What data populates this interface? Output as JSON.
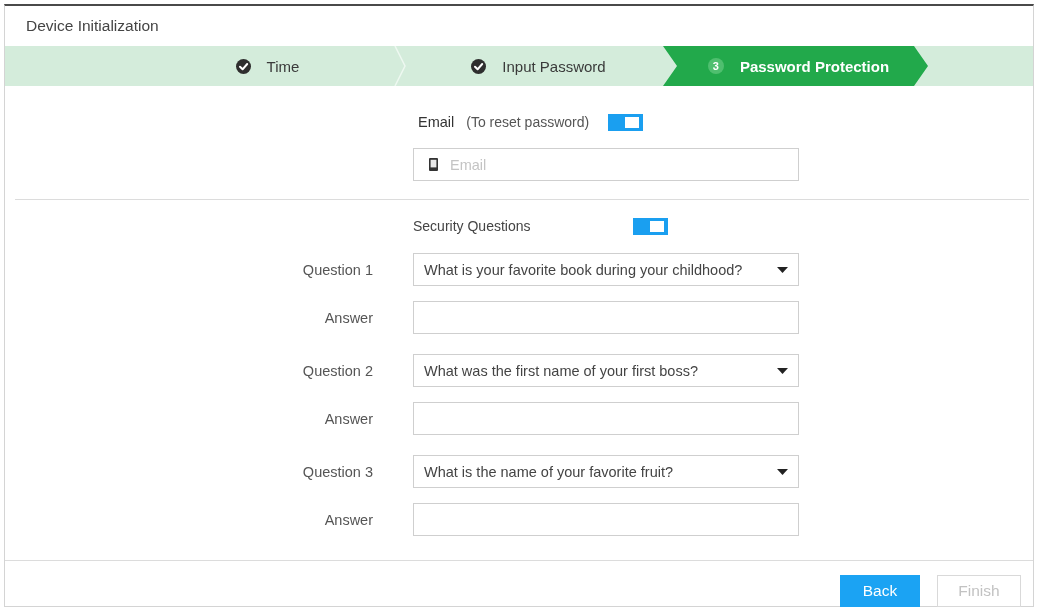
{
  "window": {
    "title": "Device Initialization"
  },
  "steps": [
    {
      "label": "Time",
      "kind": "done"
    },
    {
      "label": "Input Password",
      "kind": "done"
    },
    {
      "label": "Password Protection",
      "kind": "current",
      "number": "3"
    }
  ],
  "email": {
    "label": "Email",
    "hint": "(To reset password)",
    "on": true,
    "field": {
      "placeholder": "Email"
    }
  },
  "security_questions": {
    "label": "Security Questions",
    "on": true,
    "questions": [
      {
        "label": "Question 1",
        "value": "What is your favorite book during your childhood?",
        "answer_label": "Answer"
      },
      {
        "label": "Question 2",
        "value": "What was the first name of your first boss?",
        "answer_label": "Answer"
      },
      {
        "label": "Question 3",
        "value": "What is the name of your favorite fruit?",
        "answer_label": "Answer"
      }
    ]
  },
  "buttons": [
    {
      "label": "Back",
      "disabled": false
    },
    {
      "label": "Finish",
      "disabled": true
    }
  ]
}
